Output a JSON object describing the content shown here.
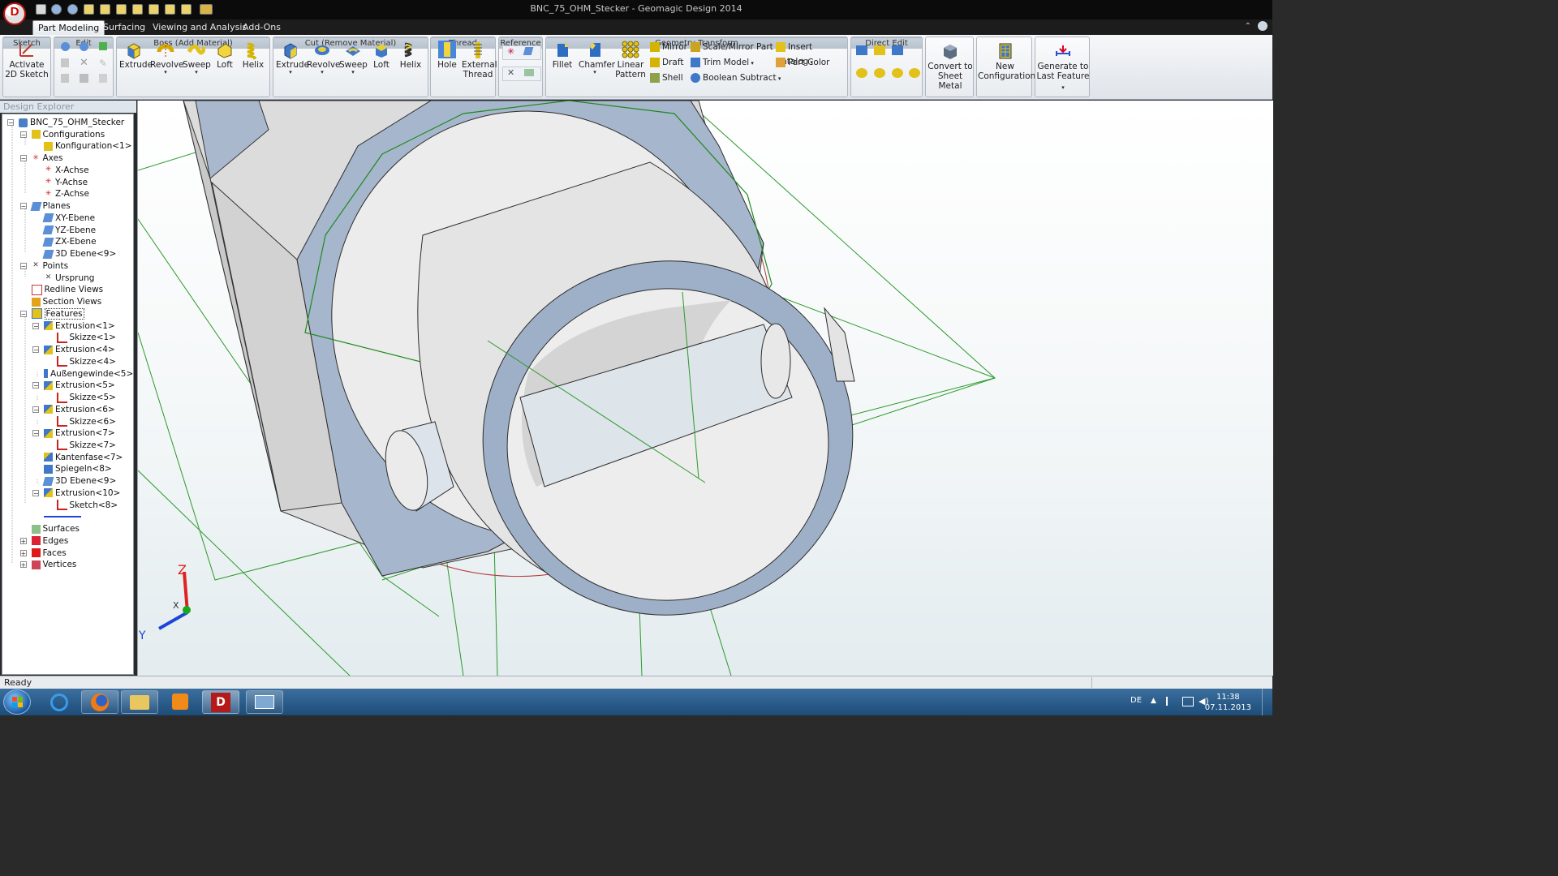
{
  "window": {
    "title": "BNC_75_OHM_Stecker - Geomagic Design 2014",
    "logo_letter": "D"
  },
  "tabs": [
    "Part Modeling",
    "Surfacing",
    "Viewing and Analysis",
    "Add-Ons"
  ],
  "ribbon": {
    "sketch": {
      "label": "Sketch",
      "activate": "Activate",
      "activate2": "2D Sketch"
    },
    "edit": {
      "label": "Edit"
    },
    "boss": {
      "label": "Boss (Add Material)",
      "items": [
        "Extrude",
        "Revolve",
        "Sweep",
        "Loft",
        "Helix"
      ]
    },
    "cut": {
      "label": "Cut (Remove Material)",
      "items": [
        "Extrude",
        "Revolve",
        "Sweep",
        "Loft",
        "Helix"
      ]
    },
    "thread": {
      "label": "Thread",
      "hole": "Hole",
      "external1": "External",
      "external2": "Thread"
    },
    "reference": {
      "label": "Reference"
    },
    "geometry": {
      "label": "Geometry Transform",
      "fillet": "Fillet",
      "chamfer": "Chamfer",
      "linear1": "Linear",
      "linear2": "Pattern",
      "mirror": "Mirror",
      "draft": "Draft",
      "shell": "Shell",
      "scale_mirror": "Scale/Mirror Part",
      "trim_model": "Trim Model",
      "boolean_subtract": "Boolean Subtract",
      "insert_catalog": "Insert Catalog",
      "part_color": "Part Color"
    },
    "direct_edit": {
      "label": "Direct Edit"
    },
    "convert": {
      "line1": "Convert to",
      "line2": "Sheet Metal"
    },
    "new_config": {
      "line1": "New",
      "line2": "Configuration"
    },
    "generate": {
      "line1": "Generate to",
      "line2": "Last Feature"
    }
  },
  "explorer": {
    "header": "Design Explorer",
    "tree": [
      {
        "label": "BNC_75_OHM_Stecker",
        "level": 0,
        "icon": "part-icon",
        "exp": "-"
      },
      {
        "label": "Configurations",
        "level": 1,
        "icon": "config-icon",
        "exp": "-"
      },
      {
        "label": "Konfiguration<1>",
        "level": 2,
        "icon": "config-icon"
      },
      {
        "label": "Axes",
        "level": 1,
        "icon": "axis-icon",
        "exp": "-"
      },
      {
        "label": "X-Achse",
        "level": 2,
        "icon": "axis-icon"
      },
      {
        "label": "Y-Achse",
        "level": 2,
        "icon": "axis-icon"
      },
      {
        "label": "Z-Achse",
        "level": 2,
        "icon": "axis-icon"
      },
      {
        "label": "Planes",
        "level": 1,
        "icon": "plane-icon",
        "exp": "-"
      },
      {
        "label": "XY-Ebene",
        "level": 2,
        "icon": "plane-icon"
      },
      {
        "label": "YZ-Ebene",
        "level": 2,
        "icon": "plane-icon"
      },
      {
        "label": "ZX-Ebene",
        "level": 2,
        "icon": "plane-icon"
      },
      {
        "label": "3D Ebene<9>",
        "level": 2,
        "icon": "plane-icon"
      },
      {
        "label": "Points",
        "level": 1,
        "icon": "point-icon",
        "exp": "-"
      },
      {
        "label": "Ursprung",
        "level": 2,
        "icon": "point-icon"
      },
      {
        "label": "Redline Views",
        "level": 1,
        "icon": "redline-icon"
      },
      {
        "label": "Section Views",
        "level": 1,
        "icon": "section-icon"
      },
      {
        "label": "Features",
        "level": 1,
        "icon": "feature-icon",
        "exp": "-",
        "selected": true
      },
      {
        "label": "Extrusion<1>",
        "level": 2,
        "icon": "extrude-icon",
        "exp": "-"
      },
      {
        "label": "Skizze<1>",
        "level": 3,
        "icon": "sketch-icon"
      },
      {
        "label": "Extrusion<4>",
        "level": 2,
        "icon": "extrude-icon",
        "exp": "-"
      },
      {
        "label": "Skizze<4>",
        "level": 3,
        "icon": "sketch-icon"
      },
      {
        "label": "Außengewinde<5>",
        "level": 2,
        "icon": "thread-icon"
      },
      {
        "label": "Extrusion<5>",
        "level": 2,
        "icon": "extrude-icon",
        "exp": "-"
      },
      {
        "label": "Skizze<5>",
        "level": 3,
        "icon": "sketch-icon"
      },
      {
        "label": "Extrusion<6>",
        "level": 2,
        "icon": "extrude-icon",
        "exp": "-"
      },
      {
        "label": "Skizze<6>",
        "level": 3,
        "icon": "sketch-icon"
      },
      {
        "label": "Extrusion<7>",
        "level": 2,
        "icon": "extrude-icon",
        "exp": "-"
      },
      {
        "label": "Skizze<7>",
        "level": 3,
        "icon": "sketch-icon"
      },
      {
        "label": "Kantenfase<7>",
        "level": 2,
        "icon": "chamfer-icon"
      },
      {
        "label": "Spiegeln<8>",
        "level": 2,
        "icon": "mirror-icon"
      },
      {
        "label": "3D Ebene<9>",
        "level": 2,
        "icon": "plane-icon"
      },
      {
        "label": "Extrusion<10>",
        "level": 2,
        "icon": "extrude-icon",
        "exp": "-"
      },
      {
        "label": "Sketch<8>",
        "level": 3,
        "icon": "sketch-icon"
      },
      {
        "label": "",
        "level": 2,
        "icon": "rollback-bar"
      },
      {
        "label": "Surfaces",
        "level": 1,
        "icon": "surface-icon"
      },
      {
        "label": "Edges",
        "level": 1,
        "icon": "edge-icon",
        "exp": "+"
      },
      {
        "label": "Faces",
        "level": 1,
        "icon": "face-icon",
        "exp": "+"
      },
      {
        "label": "Vertices",
        "level": 1,
        "icon": "vertex-icon",
        "exp": "+"
      }
    ]
  },
  "triad": {
    "z": "Z",
    "x": "X",
    "y": "Y"
  },
  "status": {
    "text": "Ready"
  },
  "taskbar": {
    "lang": "DE",
    "time": "11:38",
    "date": "07.11.2013"
  },
  "colors": {
    "part_face": "#9fb1c9",
    "part_body": "#e4e4e4",
    "sketch_green": "#1f9a1f",
    "sketch_red": "#c0392b"
  }
}
